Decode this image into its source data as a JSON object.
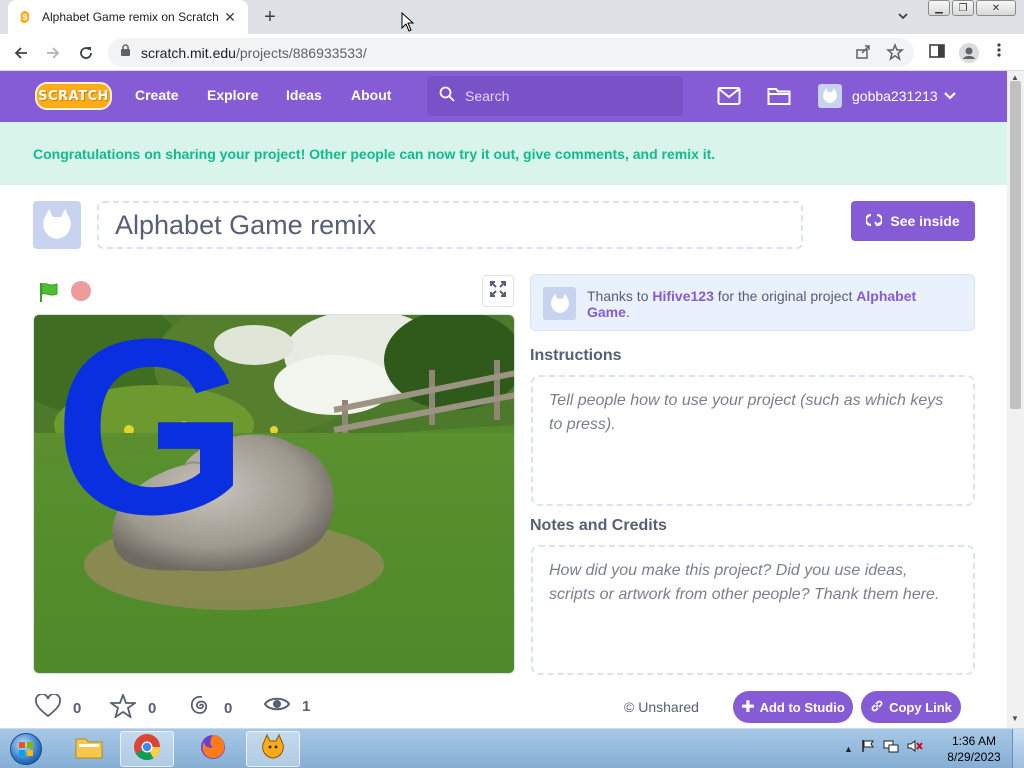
{
  "browser": {
    "tab_title": "Alphabet Game remix on Scratch",
    "url_host": "scratch.mit.edu",
    "url_path": "/projects/886933533/"
  },
  "scratch_nav": {
    "logo_text": "SCRATCH",
    "links": [
      "Create",
      "Explore",
      "Ideas",
      "About"
    ],
    "search_placeholder": "Search",
    "username": "gobba231213"
  },
  "banner": {
    "message": "Congratulations on sharing your project! Other people can now try it out, give comments, and remix it."
  },
  "project": {
    "title": "Alphabet Game remix",
    "see_inside_label": "See inside",
    "stage_letter": "G"
  },
  "remix_credit": {
    "prefix": "Thanks to",
    "author": "Hifive123",
    "middle": "for the original project",
    "original_title": "Alphabet Game",
    "suffix": "."
  },
  "instructions": {
    "heading": "Instructions",
    "placeholder": "Tell people how to use your project (such as which keys to press)."
  },
  "notes": {
    "heading": "Notes and Credits",
    "placeholder": "How did you make this project? Did you use ideas, scripts or artwork from other people? Thank them here."
  },
  "stats": {
    "loves": "0",
    "favorites": "0",
    "remixes": "0",
    "views": "1"
  },
  "share": {
    "status": "Unshared",
    "add_to_studio_label": "Add to Studio",
    "copy_link_label": "Copy Link"
  },
  "taskbar": {
    "time": "1:36 AM",
    "date": "8/29/2023"
  },
  "colors": {
    "scratch_purple": "#855cd6",
    "banner_bg": "#d9f4ea",
    "banner_text": "#0fbd8c",
    "stage_letter": "#0a2fe0"
  }
}
